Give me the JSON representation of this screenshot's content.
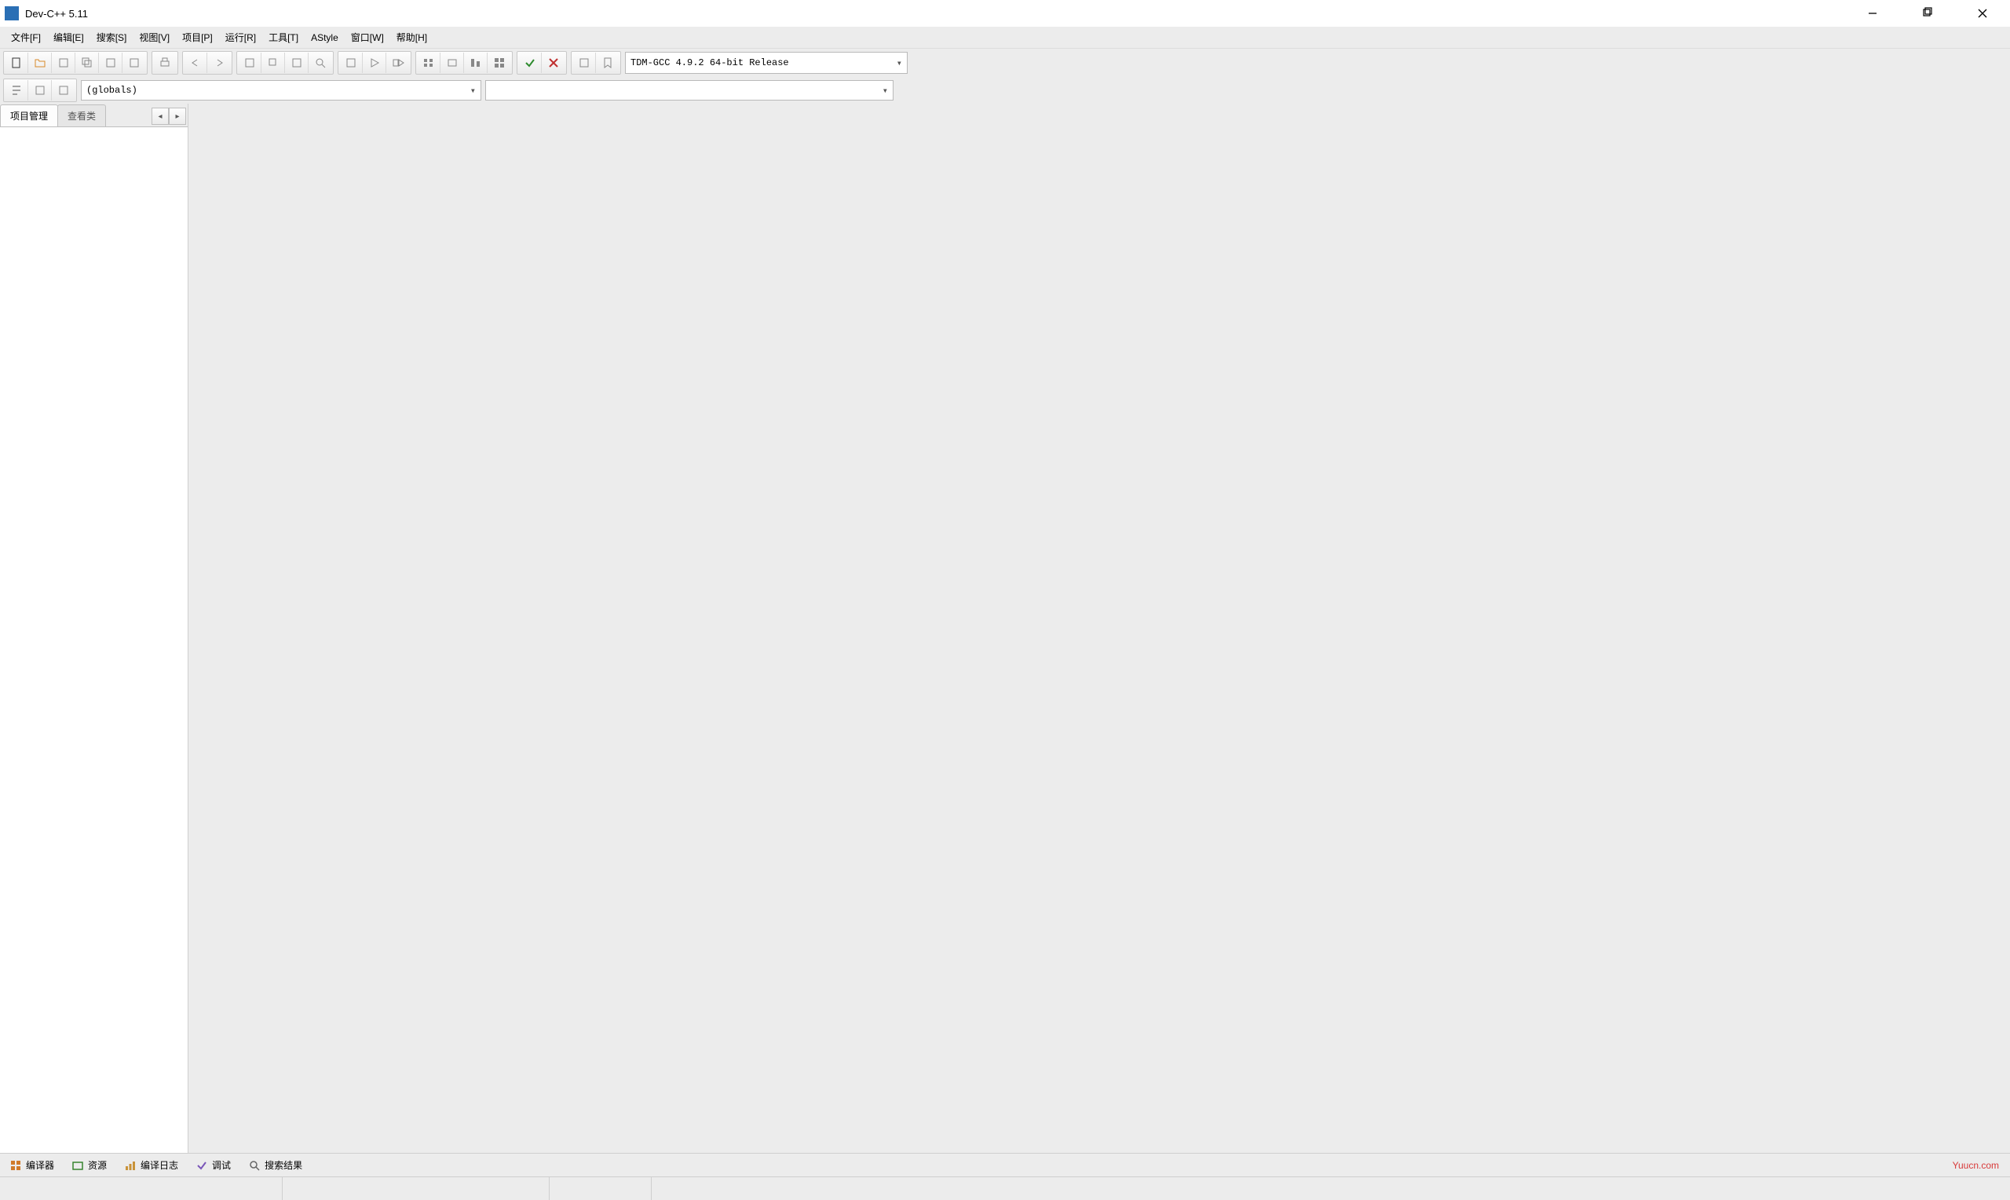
{
  "window": {
    "title": "Dev-C++ 5.11"
  },
  "menu": {
    "items": [
      "文件[F]",
      "编辑[E]",
      "搜索[S]",
      "视图[V]",
      "项目[P]",
      "运行[R]",
      "工具[T]",
      "AStyle",
      "窗口[W]",
      "帮助[H]"
    ]
  },
  "toolbar": {
    "compiler_selected": "TDM-GCC 4.9.2 64-bit Release"
  },
  "scope": {
    "globals_label": "(globals)",
    "member_selected": ""
  },
  "side": {
    "tab_project": "项目管理",
    "tab_classes": "查看类"
  },
  "bottom": {
    "tabs": [
      "编译器",
      "资源",
      "编译日志",
      "调试",
      "搜索结果"
    ]
  },
  "watermark": "Yuucn.com"
}
